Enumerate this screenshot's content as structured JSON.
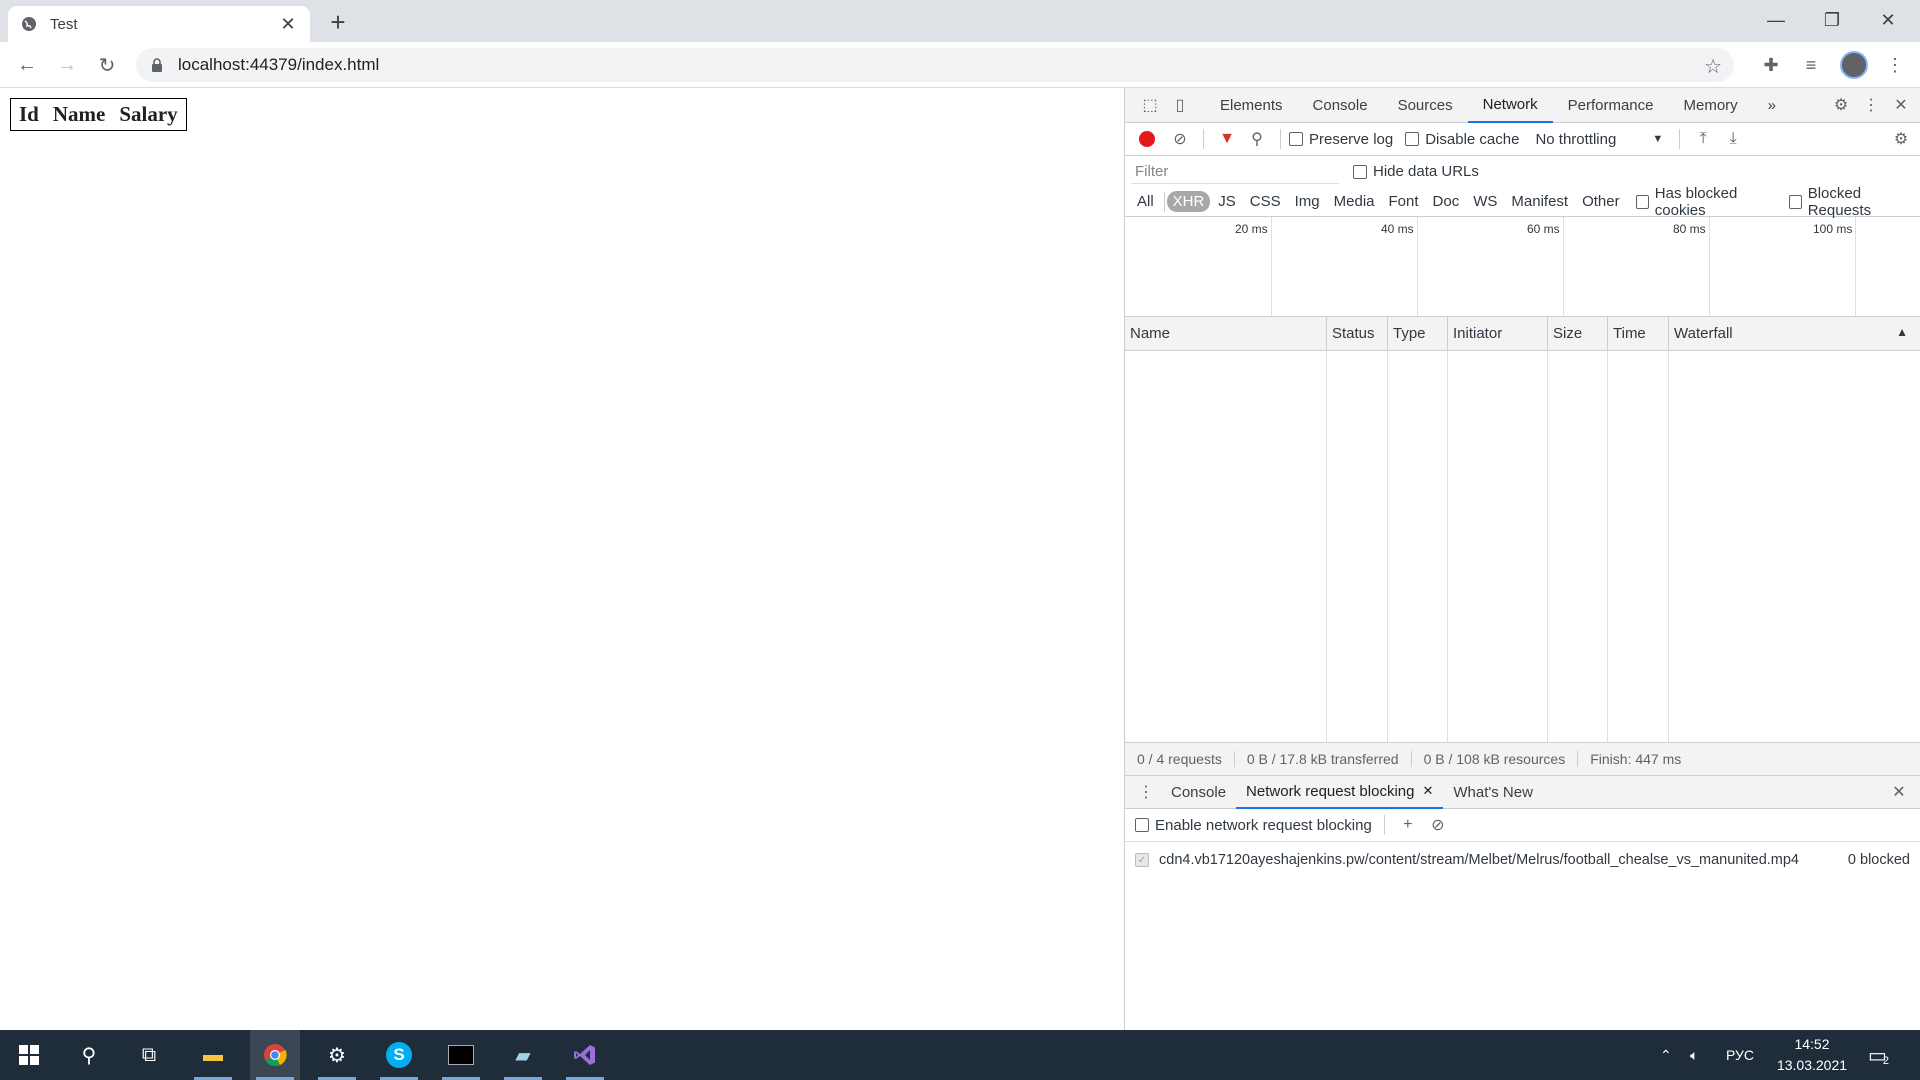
{
  "browser": {
    "tab_title": "Test",
    "url": "localhost:44379/index.html"
  },
  "page": {
    "table_headers": [
      "Id",
      "Name",
      "Salary"
    ]
  },
  "devtools": {
    "tabs": [
      "Elements",
      "Console",
      "Sources",
      "Network",
      "Performance",
      "Memory"
    ],
    "active_tab": "Network",
    "more_tabs": "»",
    "toolbar": {
      "preserve_log": "Preserve log",
      "disable_cache": "Disable cache",
      "throttling": "No throttling"
    },
    "filter": {
      "placeholder": "Filter",
      "hide_data_urls": "Hide data URLs"
    },
    "types": [
      "All",
      "XHR",
      "JS",
      "CSS",
      "Img",
      "Media",
      "Font",
      "Doc",
      "WS",
      "Manifest",
      "Other"
    ],
    "active_type": "XHR",
    "has_blocked_cookies": "Has blocked cookies",
    "blocked_requests": "Blocked Requests",
    "overview_ticks": [
      "20 ms",
      "40 ms",
      "60 ms",
      "80 ms",
      "100 ms"
    ],
    "columns": [
      "Name",
      "Status",
      "Type",
      "Initiator",
      "Size",
      "Time",
      "Waterfall"
    ],
    "summary": {
      "requests": "0 / 4 requests",
      "transferred": "0 B / 17.8 kB transferred",
      "resources": "0 B / 108 kB resources",
      "finish": "Finish: 447 ms"
    },
    "drawer": {
      "tabs": [
        "Console",
        "Network request blocking",
        "What's New"
      ],
      "active_tab": "Network request blocking",
      "enable_label": "Enable network request blocking",
      "blocked_pattern": "cdn4.vb17120ayeshajenkins.pw/content/stream/Melbet/Melrus/football_chealse_vs_manunited.mp4",
      "blocked_count": "0 blocked"
    }
  },
  "taskbar": {
    "time": "14:52",
    "date": "13.03.2021",
    "language": "РУС",
    "notification_count": "2"
  },
  "colors": {
    "record": "#e21a1a",
    "accent": "#1a73e8",
    "taskbar": "#1f2d3a"
  }
}
